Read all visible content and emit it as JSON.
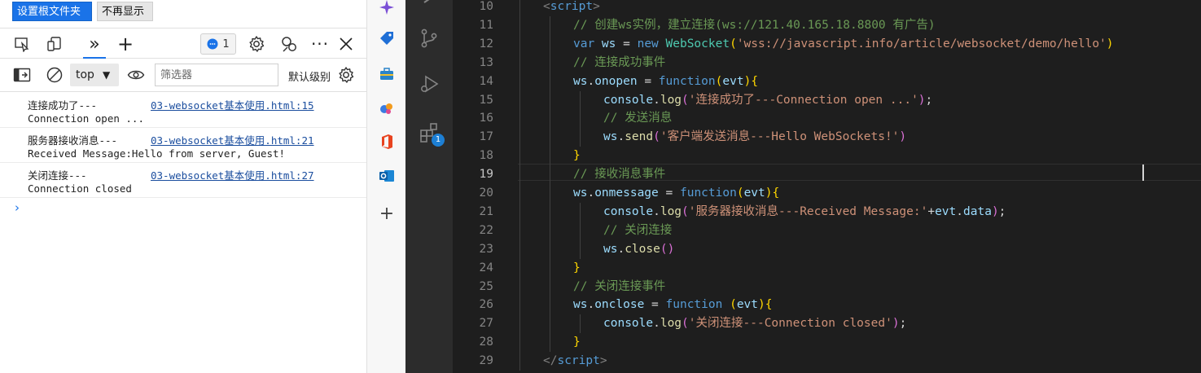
{
  "devtools": {
    "top_buttons": {
      "set_root": "设置根文件夹",
      "no_show": "不再显示"
    },
    "issues_count": "1",
    "context": "top",
    "filter_placeholder": "筛选器",
    "level_label": "默认级别",
    "messages": [
      {
        "line1": "连接成功了---",
        "line2": "Connection open ...",
        "source": "03-websocket基本使用.html:15"
      },
      {
        "line1": "服务器接收消息---",
        "line2": "Received Message:Hello from server, Guest!",
        "source": "03-websocket基本使用.html:21"
      },
      {
        "line1": "关闭连接---",
        "line2": "Connection closed",
        "source": "03-websocket基本使用.html:27"
      }
    ],
    "prompt": "›"
  },
  "vscode": {
    "extensions_badge": "1",
    "current_line": 19,
    "lines": [
      {
        "n": "10",
        "indent": 1,
        "tokens": [
          [
            "<",
            "tagb"
          ],
          [
            "script",
            "tag"
          ],
          [
            ">",
            "tagb"
          ]
        ]
      },
      {
        "n": "11",
        "indent": 2,
        "tokens": [
          [
            "// 创建ws实例，建立连接(ws://121.40.165.18.8800 有广告)",
            "cmt"
          ]
        ]
      },
      {
        "n": "12",
        "indent": 2,
        "tokens": [
          [
            "var ",
            "kw"
          ],
          [
            "ws",
            "var"
          ],
          [
            " = ",
            "plain"
          ],
          [
            "new ",
            "kw"
          ],
          [
            "WebSocket",
            "cls"
          ],
          [
            "(",
            "br1"
          ],
          [
            "'wss://javascript.info/article/websocket/demo/hello'",
            "str"
          ],
          [
            ")",
            "br1"
          ]
        ]
      },
      {
        "n": "13",
        "indent": 2,
        "tokens": [
          [
            "// 连接成功事件",
            "cmt"
          ]
        ]
      },
      {
        "n": "14",
        "indent": 2,
        "tokens": [
          [
            "ws",
            "var"
          ],
          [
            ".",
            "plain"
          ],
          [
            "onopen",
            "var"
          ],
          [
            " = ",
            "plain"
          ],
          [
            "function",
            "kw"
          ],
          [
            "(",
            "br1"
          ],
          [
            "evt",
            "var"
          ],
          [
            ")",
            "br1"
          ],
          [
            "{",
            "br1"
          ]
        ]
      },
      {
        "n": "15",
        "indent": 3,
        "tokens": [
          [
            "console",
            "var"
          ],
          [
            ".",
            "plain"
          ],
          [
            "log",
            "fn"
          ],
          [
            "(",
            "br2"
          ],
          [
            "'连接成功了---Connection open ...'",
            "str"
          ],
          [
            ")",
            "br2"
          ],
          [
            ";",
            "plain"
          ]
        ]
      },
      {
        "n": "16",
        "indent": 3,
        "tokens": [
          [
            "// 发送消息",
            "cmt"
          ]
        ]
      },
      {
        "n": "17",
        "indent": 3,
        "tokens": [
          [
            "ws",
            "var"
          ],
          [
            ".",
            "plain"
          ],
          [
            "send",
            "fn"
          ],
          [
            "(",
            "br2"
          ],
          [
            "'客户端发送消息---Hello WebSockets!'",
            "str"
          ],
          [
            ")",
            "br2"
          ]
        ]
      },
      {
        "n": "18",
        "indent": 2,
        "tokens": [
          [
            "}",
            "br1"
          ]
        ]
      },
      {
        "n": "19",
        "indent": 2,
        "tokens": [
          [
            "// 接收消息事件",
            "cmt"
          ]
        ]
      },
      {
        "n": "20",
        "indent": 2,
        "tokens": [
          [
            "ws",
            "var"
          ],
          [
            ".",
            "plain"
          ],
          [
            "onmessage",
            "var"
          ],
          [
            " = ",
            "plain"
          ],
          [
            "function",
            "kw"
          ],
          [
            "(",
            "br1"
          ],
          [
            "evt",
            "var"
          ],
          [
            ")",
            "br1"
          ],
          [
            "{",
            "br1"
          ]
        ]
      },
      {
        "n": "21",
        "indent": 3,
        "tokens": [
          [
            "console",
            "var"
          ],
          [
            ".",
            "plain"
          ],
          [
            "log",
            "fn"
          ],
          [
            "(",
            "br2"
          ],
          [
            "'服务器接收消息---Received Message:'",
            "str"
          ],
          [
            "+",
            "plain"
          ],
          [
            "evt",
            "var"
          ],
          [
            ".",
            "plain"
          ],
          [
            "data",
            "var"
          ],
          [
            ")",
            "br2"
          ],
          [
            ";",
            "plain"
          ]
        ]
      },
      {
        "n": "22",
        "indent": 3,
        "tokens": [
          [
            "// 关闭连接",
            "cmt"
          ]
        ]
      },
      {
        "n": "23",
        "indent": 3,
        "tokens": [
          [
            "ws",
            "var"
          ],
          [
            ".",
            "plain"
          ],
          [
            "close",
            "fn"
          ],
          [
            "(",
            "br2"
          ],
          [
            ")",
            "br2"
          ]
        ]
      },
      {
        "n": "24",
        "indent": 2,
        "tokens": [
          [
            "}",
            "br1"
          ]
        ]
      },
      {
        "n": "25",
        "indent": 2,
        "tokens": [
          [
            "// 关闭连接事件",
            "cmt"
          ]
        ]
      },
      {
        "n": "26",
        "indent": 2,
        "tokens": [
          [
            "ws",
            "var"
          ],
          [
            ".",
            "plain"
          ],
          [
            "onclose",
            "var"
          ],
          [
            " = ",
            "plain"
          ],
          [
            "function ",
            "kw"
          ],
          [
            "(",
            "br1"
          ],
          [
            "evt",
            "var"
          ],
          [
            ")",
            "br1"
          ],
          [
            "{",
            "br1"
          ]
        ]
      },
      {
        "n": "27",
        "indent": 3,
        "tokens": [
          [
            "console",
            "var"
          ],
          [
            ".",
            "plain"
          ],
          [
            "log",
            "fn"
          ],
          [
            "(",
            "br2"
          ],
          [
            "'关闭连接---Connection closed'",
            "str"
          ],
          [
            ")",
            "br2"
          ],
          [
            ";",
            "plain"
          ]
        ]
      },
      {
        "n": "28",
        "indent": 2,
        "tokens": [
          [
            "}",
            "br1"
          ]
        ]
      },
      {
        "n": "29",
        "indent": 1,
        "tokens": [
          [
            "</",
            "tagb"
          ],
          [
            "script",
            "tag"
          ],
          [
            ">",
            "tagb"
          ]
        ]
      }
    ]
  },
  "colors": {
    "accent": "#1a73e8",
    "editor_bg": "#1e1e1e",
    "activity_bg": "#2c2c2c"
  }
}
